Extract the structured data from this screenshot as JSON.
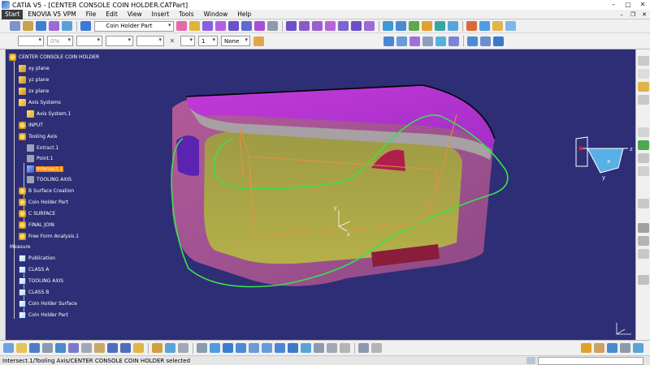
{
  "window": {
    "title": "CATIA V5 - [CENTER CONSOLE COIN HOLDER.CATPart]"
  },
  "menu": {
    "items": [
      "Start",
      "ENOVIA V5 VPM",
      "File",
      "Edit",
      "View",
      "Insert",
      "Tools",
      "Window",
      "Help"
    ]
  },
  "toolbar": {
    "part_combo": "Coin Holder Part",
    "line_percent": "0%",
    "linetype_value": "1",
    "layer_value": "None"
  },
  "tree": {
    "root": "CENTER CONSOLE COIN HOLDER",
    "nodes": [
      {
        "label": "xy plane"
      },
      {
        "label": "yz plane"
      },
      {
        "label": "zx plane"
      },
      {
        "label": "Axis Systems"
      },
      {
        "label": "Axis System.1"
      },
      {
        "label": "INPUT"
      },
      {
        "label": "Tooling Axis"
      },
      {
        "label": "Extract.1"
      },
      {
        "label": "Point.1"
      },
      {
        "label": "Intersect.1"
      },
      {
        "label": "TOOLING AXIS"
      },
      {
        "label": "B Surface Creation"
      },
      {
        "label": "Coin Holder Part"
      },
      {
        "label": "C SURFACE"
      },
      {
        "label": "FINAL JOIN"
      },
      {
        "label": "Free Form Analysis.1"
      },
      {
        "label": "Measure"
      },
      {
        "label": "Publication"
      },
      {
        "label": "CLASS A"
      },
      {
        "label": "TOOLING AXIS"
      },
      {
        "label": "CLASS B"
      },
      {
        "label": "Coin Holder Surface"
      },
      {
        "label": "Coin Holder Part"
      }
    ]
  },
  "viewport": {
    "background_color": "#2d2e76",
    "compass_axes": [
      "x",
      "y",
      "z"
    ]
  },
  "status": {
    "message": "Intersect.1/Tooling Axis/CENTER CONSOLE COIN HOLDER selected"
  }
}
